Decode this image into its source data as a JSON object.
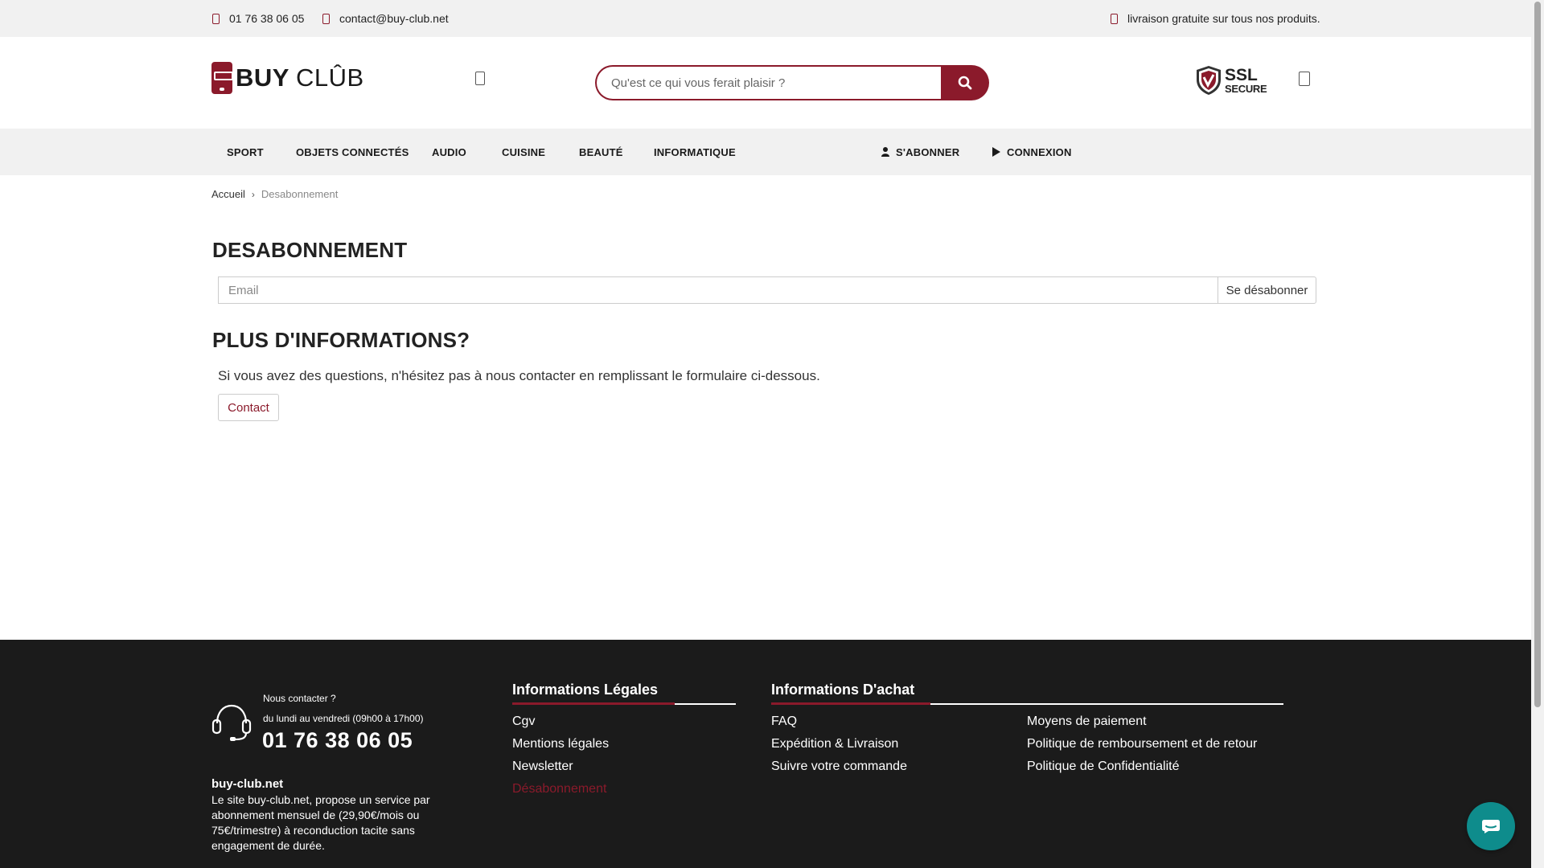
{
  "topbar": {
    "phone": "01 76 38 06 05",
    "email": "contact@buy-club.net",
    "shipping": "livraison gratuite sur tous nos produits."
  },
  "header": {
    "logo_buy": "BUY",
    "logo_club": "CLÛB",
    "search_placeholder": "Qu'est ce qui vous ferait plaisir ?",
    "ssl_title": "SSL",
    "ssl_subtitle": "SECURE"
  },
  "nav": {
    "items": [
      "SPORT",
      "OBJETS CONNECTÉS",
      "AUDIO",
      "CUISINE",
      "BEAUTÉ",
      "INFORMATIQUE"
    ],
    "subscribe": "S'ABONNER",
    "login": "CONNEXION"
  },
  "breadcrumb": {
    "home": "Accueil",
    "separator": "›",
    "current": "Desabonnement"
  },
  "main": {
    "title": "DESABONNEMENT",
    "email_placeholder": "Email",
    "unsubscribe_button": "Se désabonner",
    "more_title": "PLUS D'INFORMATIONS?",
    "info_text": "Si vous avez des questions, n'hésitez pas à nous contacter en remplissant le formulaire ci-dessous.",
    "contact_button": "Contact"
  },
  "footer": {
    "contact_question": "Nous contacter ?",
    "hours": "du lundi au vendredi (09h00 à 17h00)",
    "phone": "01 76 38 06 05",
    "site": "buy-club.net",
    "description": "Le site buy-club.net, propose un service par abonnement mensuel de (29,90€/mois ou 75€/trimestre) à reconduction tacite sans engagement de durée.",
    "legal": {
      "title": "Informations Légales",
      "links": [
        "Cgv",
        "Mentions légales",
        "Newsletter",
        "Désabonnement"
      ]
    },
    "purchase": {
      "title": "Informations D'achat",
      "links_left": [
        "FAQ",
        "Expédition & Livraison",
        "Suivre votre commande"
      ],
      "links_right": [
        "Moyens de paiement",
        "Politique de remboursement et de retour",
        "Politique de Confidentialité"
      ]
    }
  },
  "colors": {
    "brand": "#8b1a2b",
    "footer_bg": "#1b1b1b",
    "topbar_bg": "#f1f1f1",
    "chat": "#0e8c8c"
  },
  "icons": {
    "phone": "phone-icon",
    "mail": "mail-icon",
    "truck": "truck-icon",
    "search": "search-icon",
    "user": "user-icon",
    "play": "play-icon",
    "headset": "headset-icon",
    "chat": "chat-icon"
  }
}
